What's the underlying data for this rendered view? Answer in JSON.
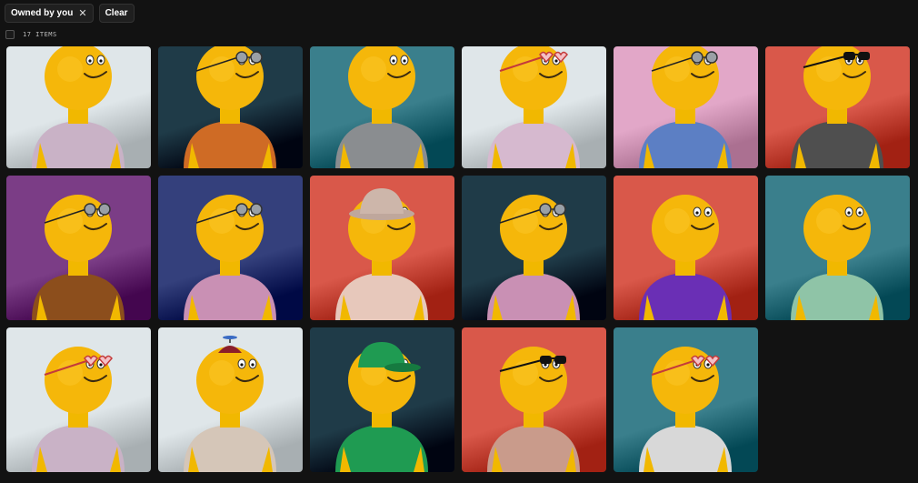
{
  "filters": {
    "owned_chip_label": "Owned by you",
    "owned_chip_close": "✕",
    "clear_label": "Clear"
  },
  "results": {
    "count_label": "17 ITEMS"
  },
  "items": [
    {
      "bg": "#dfe6e9",
      "shirt": "#c9b2c6",
      "acc": "none"
    },
    {
      "bg": "#1f3b48",
      "shirt": "#cf6b25",
      "acc": "roundglasses"
    },
    {
      "bg": "#3a7f8c",
      "shirt": "#8a8d90",
      "acc": "none"
    },
    {
      "bg": "#dfe6e9",
      "shirt": "#d6b9cf",
      "acc": "heartglasses"
    },
    {
      "bg": "#e2a7c8",
      "shirt": "#5c7fc4",
      "acc": "roundglasses"
    },
    {
      "bg": "#d9584a",
      "shirt": "#4f4f4f",
      "acc": "sunglasses"
    },
    {
      "bg": "#7b3d86",
      "shirt": "#8c4e1c",
      "acc": "roundglasses"
    },
    {
      "bg": "#34407c",
      "shirt": "#c990b4",
      "acc": "roundglasses"
    },
    {
      "bg": "#d9584a",
      "shirt": "#e7c8bb",
      "acc": "bucket"
    },
    {
      "bg": "#1f3b48",
      "shirt": "#c990b4",
      "acc": "roundglasses"
    },
    {
      "bg": "#d9584a",
      "shirt": "#6a2fb5",
      "acc": "none"
    },
    {
      "bg": "#3a7f8c",
      "shirt": "#8fc4a7",
      "acc": "none"
    },
    {
      "bg": "#dfe6e9",
      "shirt": "#c9b2c6",
      "acc": "heartglasses"
    },
    {
      "bg": "#dfe6e9",
      "shirt": "#d5c6b8",
      "acc": "propeller"
    },
    {
      "bg": "#1f3b48",
      "shirt": "#1f9b52",
      "acc": "cap"
    },
    {
      "bg": "#d9584a",
      "shirt": "#c99b8b",
      "acc": "sunglasses"
    },
    {
      "bg": "#3a7f8c",
      "shirt": "#d8d8d8",
      "acc": "heartglasses"
    }
  ]
}
